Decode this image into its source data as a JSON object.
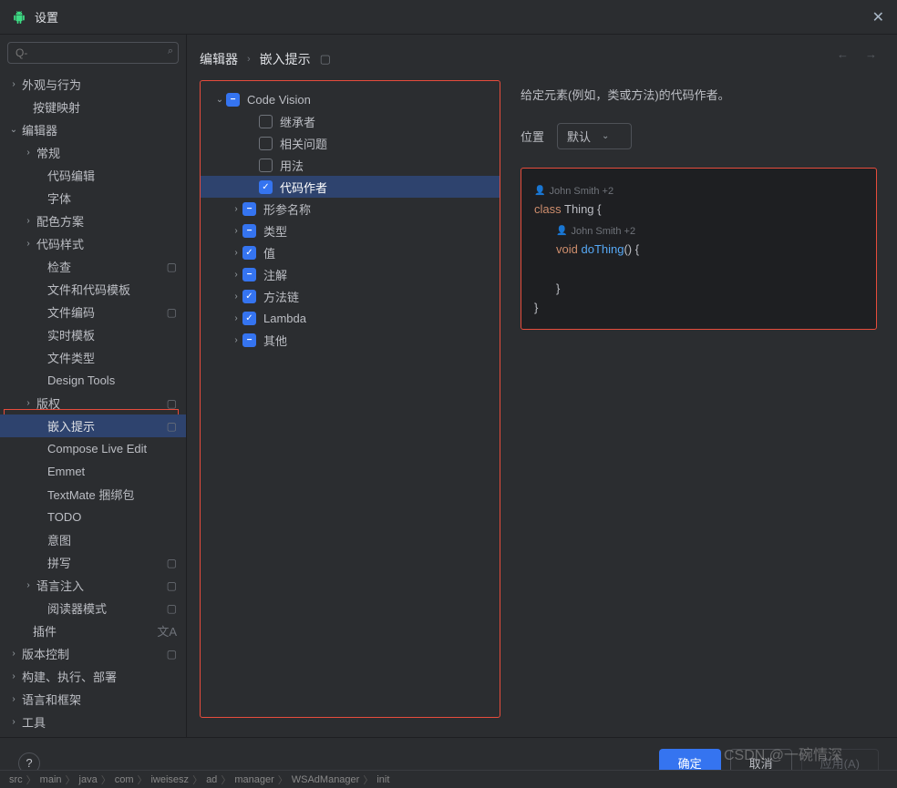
{
  "title": "设置",
  "search": {
    "placeholder": "Q-"
  },
  "breadcrumb": {
    "editor": "编辑器",
    "inlay": "嵌入提示"
  },
  "sidebar": {
    "items": [
      {
        "label": "外观与行为",
        "chevron": "›",
        "level": "l0"
      },
      {
        "label": "按键映射",
        "level": "l0",
        "noindent": true
      },
      {
        "label": "编辑器",
        "chevron": "⌄",
        "level": "l0"
      },
      {
        "label": "常规",
        "chevron": "›",
        "level": "l1"
      },
      {
        "label": "代码编辑",
        "level": "l2"
      },
      {
        "label": "字体",
        "level": "l2"
      },
      {
        "label": "配色方案",
        "chevron": "›",
        "level": "l1"
      },
      {
        "label": "代码样式",
        "chevron": "›",
        "level": "l1"
      },
      {
        "label": "检查",
        "level": "l2",
        "badge": "▢"
      },
      {
        "label": "文件和代码模板",
        "level": "l2"
      },
      {
        "label": "文件编码",
        "level": "l2",
        "badge": "▢"
      },
      {
        "label": "实时模板",
        "level": "l2"
      },
      {
        "label": "文件类型",
        "level": "l2"
      },
      {
        "label": "Design Tools",
        "level": "l2"
      },
      {
        "label": "版权",
        "chevron": "›",
        "level": "l1",
        "badge": "▢"
      },
      {
        "label": "嵌入提示",
        "level": "l2",
        "badge": "▢",
        "selected": true
      },
      {
        "label": "Compose Live Edit",
        "level": "l2"
      },
      {
        "label": "Emmet",
        "level": "l2"
      },
      {
        "label": "TextMate 捆绑包",
        "level": "l2"
      },
      {
        "label": "TODO",
        "level": "l2"
      },
      {
        "label": "意图",
        "level": "l2"
      },
      {
        "label": "拼写",
        "level": "l2",
        "badge": "▢"
      },
      {
        "label": "语言注入",
        "chevron": "›",
        "level": "l1",
        "badge": "▢"
      },
      {
        "label": "阅读器模式",
        "level": "l2",
        "badge": "▢"
      },
      {
        "label": "插件",
        "level": "l0",
        "noindent": true,
        "lang": true
      },
      {
        "label": "版本控制",
        "chevron": "›",
        "level": "l0",
        "badge": "▢"
      },
      {
        "label": "构建、执行、部署",
        "chevron": "›",
        "level": "l0"
      },
      {
        "label": "语言和框架",
        "chevron": "›",
        "level": "l0"
      },
      {
        "label": "工具",
        "chevron": "›",
        "level": "l0"
      }
    ]
  },
  "tree": [
    {
      "label": "Code Vision",
      "depth": "d1",
      "chev": "⌄",
      "state": "indet"
    },
    {
      "label": "继承者",
      "depth": "d2c",
      "state": ""
    },
    {
      "label": "相关问题",
      "depth": "d2c",
      "state": ""
    },
    {
      "label": "用法",
      "depth": "d2c",
      "state": ""
    },
    {
      "label": "代码作者",
      "depth": "d2c",
      "state": "checked",
      "sel": true
    },
    {
      "label": "形参名称",
      "depth": "d2",
      "chev": "›",
      "state": "indet"
    },
    {
      "label": "类型",
      "depth": "d2",
      "chev": "›",
      "state": "indet"
    },
    {
      "label": "值",
      "depth": "d2",
      "chev": "›",
      "state": "checked"
    },
    {
      "label": "注解",
      "depth": "d2",
      "chev": "›",
      "state": "indet"
    },
    {
      "label": "方法链",
      "depth": "d2",
      "chev": "›",
      "state": "checked"
    },
    {
      "label": "Lambda",
      "depth": "d2",
      "chev": "›",
      "state": "checked"
    },
    {
      "label": "其他",
      "depth": "d2",
      "chev": "›",
      "state": "indet"
    }
  ],
  "right": {
    "desc": "给定元素(例如，类或方法)的代码作者。",
    "posLabel": "位置",
    "posValue": "默认",
    "code": {
      "hint1": "John Smith +2",
      "kw_class": "class",
      "cls": "Thing",
      "brace_o": "{",
      "hint2": "John Smith +2",
      "kw_void": "void",
      "fn": "doThing",
      "paren": "()",
      "brace_o2": "{",
      "brace_c": "}",
      "brace_c2": "}"
    }
  },
  "footer": {
    "ok": "确定",
    "cancel": "取消",
    "apply": "应用(A)"
  },
  "watermark": "CSDN @一碗情深",
  "bottomCrumbs": [
    "src",
    "main",
    "java",
    "com",
    "iweisesz",
    "ad",
    "manager",
    "WSAdManager",
    "init"
  ]
}
